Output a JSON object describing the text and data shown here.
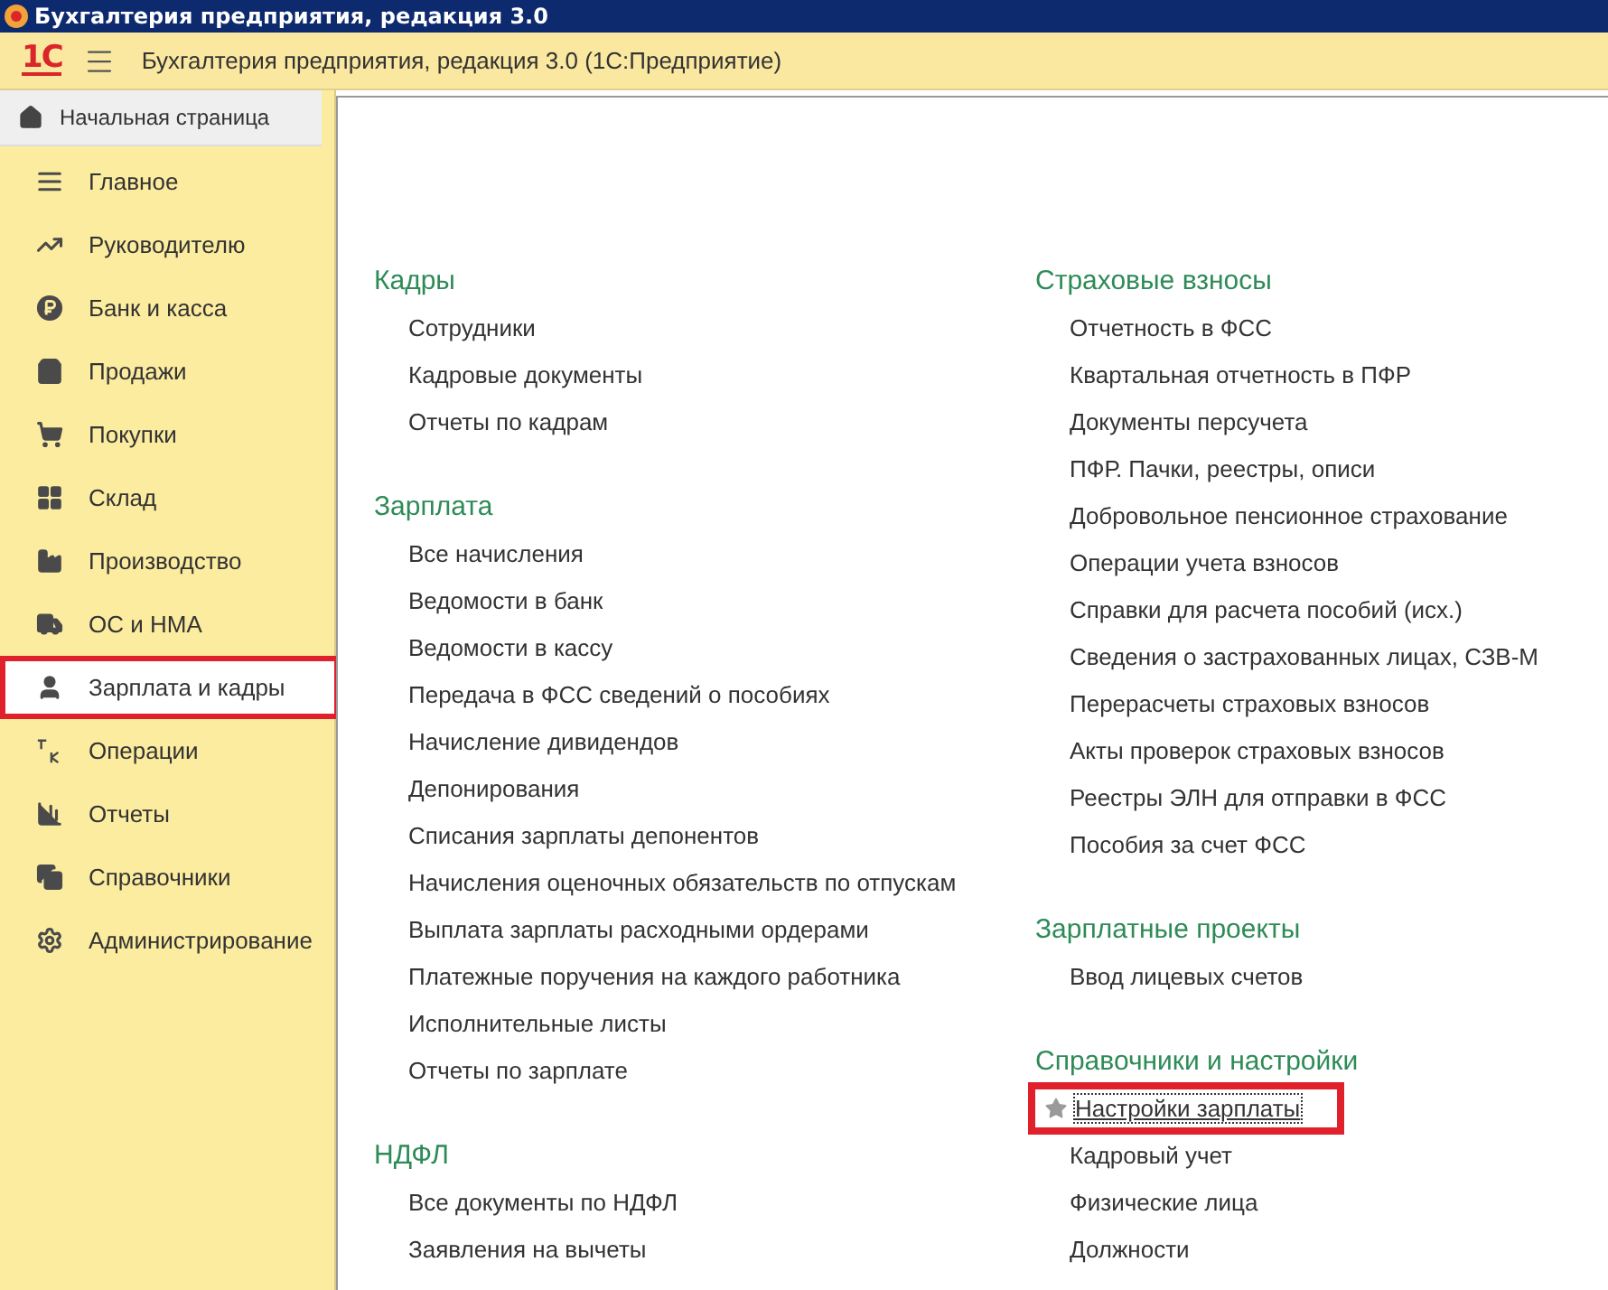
{
  "window": {
    "title": "Бухгалтерия предприятия, редакция 3.0"
  },
  "toolbar": {
    "logo": "1С",
    "title": "Бухгалтерия предприятия, редакция 3.0  (1С:Предприятие)"
  },
  "tabs": [
    {
      "label": "Начальная страница",
      "selected": false
    }
  ],
  "sidebar": {
    "items": [
      {
        "label": "Главное",
        "selected": false,
        "highlighted": false
      },
      {
        "label": "Руководителю",
        "selected": false,
        "highlighted": false
      },
      {
        "label": "Банк и касса",
        "selected": false,
        "highlighted": false
      },
      {
        "label": "Продажи",
        "selected": false,
        "highlighted": false
      },
      {
        "label": "Покупки",
        "selected": false,
        "highlighted": false
      },
      {
        "label": "Склад",
        "selected": false,
        "highlighted": false
      },
      {
        "label": "Производство",
        "selected": false,
        "highlighted": false
      },
      {
        "label": "ОС и НМА",
        "selected": false,
        "highlighted": false
      },
      {
        "label": "Зарплата и кадры",
        "selected": true,
        "highlighted": true
      },
      {
        "label": "Операции",
        "selected": false,
        "highlighted": false
      },
      {
        "label": "Отчеты",
        "selected": false,
        "highlighted": false
      },
      {
        "label": "Справочники",
        "selected": false,
        "highlighted": false
      },
      {
        "label": "Администрирование",
        "selected": false,
        "highlighted": false
      }
    ]
  },
  "columns": [
    {
      "sections": [
        {
          "title": "Кадры",
          "links": [
            {
              "label": "Сотрудники",
              "selected": false,
              "highlighted": false
            },
            {
              "label": "Кадровые документы",
              "selected": false,
              "highlighted": false
            },
            {
              "label": "Отчеты по кадрам",
              "selected": false,
              "highlighted": false
            }
          ]
        },
        {
          "title": "Зарплата",
          "links": [
            {
              "label": "Все начисления",
              "selected": false,
              "highlighted": false
            },
            {
              "label": "Ведомости в банк",
              "selected": false,
              "highlighted": false
            },
            {
              "label": "Ведомости в кассу",
              "selected": false,
              "highlighted": false
            },
            {
              "label": "Передача в ФСС сведений о пособиях",
              "selected": false,
              "highlighted": false
            },
            {
              "label": "Начисление дивидендов",
              "selected": false,
              "highlighted": false
            },
            {
              "label": "Депонирования",
              "selected": false,
              "highlighted": false
            },
            {
              "label": "Списания зарплаты депонентов",
              "selected": false,
              "highlighted": false
            },
            {
              "label": "Начисления оценочных обязательств по отпускам",
              "selected": false,
              "highlighted": false
            },
            {
              "label": "Выплата зарплаты расходными ордерами",
              "selected": false,
              "highlighted": false
            },
            {
              "label": "Платежные поручения на каждого работника",
              "selected": false,
              "highlighted": false
            },
            {
              "label": "Исполнительные листы",
              "selected": false,
              "highlighted": false
            },
            {
              "label": "Отчеты по зарплате",
              "selected": false,
              "highlighted": false
            }
          ]
        },
        {
          "title": "НДФЛ",
          "links": [
            {
              "label": "Все документы по НДФЛ",
              "selected": false,
              "highlighted": false
            },
            {
              "label": "Заявления на вычеты",
              "selected": false,
              "highlighted": false
            }
          ]
        }
      ]
    },
    {
      "sections": [
        {
          "title": "Страховые взносы",
          "links": [
            {
              "label": "Отчетность в ФСС",
              "selected": false,
              "highlighted": false
            },
            {
              "label": "Квартальная отчетность в ПФР",
              "selected": false,
              "highlighted": false
            },
            {
              "label": "Документы персучета",
              "selected": false,
              "highlighted": false
            },
            {
              "label": "ПФР. Пачки, реестры, описи",
              "selected": false,
              "highlighted": false
            },
            {
              "label": "Добровольное пенсионное страхование",
              "selected": false,
              "highlighted": false
            },
            {
              "label": "Операции учета взносов",
              "selected": false,
              "highlighted": false
            },
            {
              "label": "Справки для расчета пособий (исх.)",
              "selected": false,
              "highlighted": false
            },
            {
              "label": "Сведения о застрахованных лицах, СЗВ-М",
              "selected": false,
              "highlighted": false
            },
            {
              "label": "Перерасчеты страховых взносов",
              "selected": false,
              "highlighted": false
            },
            {
              "label": "Акты проверок страховых взносов",
              "selected": false,
              "highlighted": false
            },
            {
              "label": "Реестры ЭЛН для отправки в ФСС",
              "selected": false,
              "highlighted": false
            },
            {
              "label": "Пособия за счет ФСС",
              "selected": false,
              "highlighted": false
            }
          ]
        },
        {
          "title": "Зарплатные проекты",
          "links": [
            {
              "label": "Ввод лицевых счетов",
              "selected": false,
              "highlighted": false
            }
          ]
        },
        {
          "title": "Справочники и настройки",
          "links": [
            {
              "label": "Настройки зарплаты",
              "selected": true,
              "highlighted": true
            },
            {
              "label": "Кадровый учет",
              "selected": false,
              "highlighted": false
            },
            {
              "label": "Физические лица",
              "selected": false,
              "highlighted": false
            },
            {
              "label": "Должности",
              "selected": false,
              "highlighted": false
            }
          ]
        }
      ]
    }
  ]
}
